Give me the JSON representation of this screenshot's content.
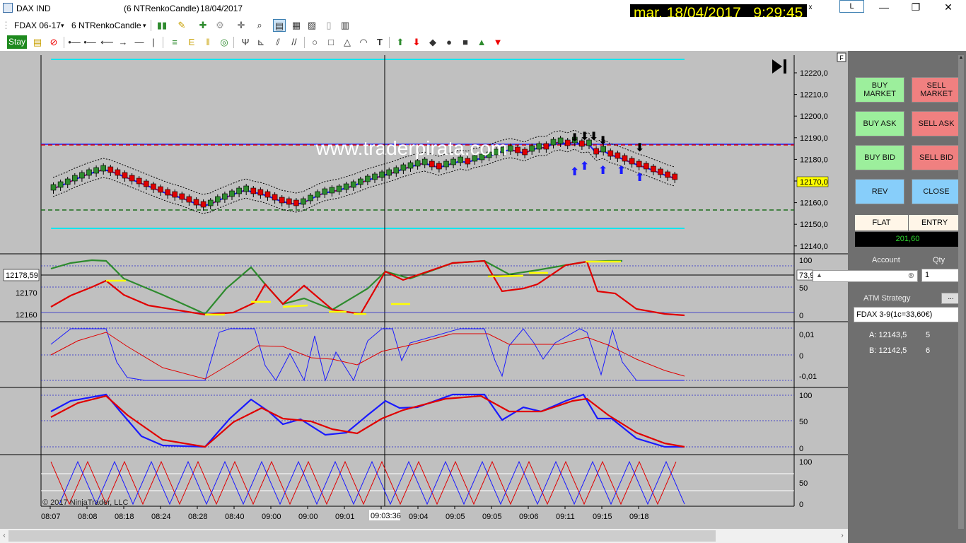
{
  "titlebar": {
    "instrument": "DAX IND",
    "chart_desc": "(6 NTRenkoCandle)",
    "date": "18/04/2017",
    "clock": "mar. 18/04/2017   9:29:45",
    "clock_close": "x",
    "layout_button": "L",
    "minimize": "—",
    "maximize": "❐",
    "close": "✕"
  },
  "toolbar": {
    "instrument_select": "FDAX 06-17",
    "bar_type_select": "6 NTRenkoCandle",
    "stay_button": "Stay",
    "dropdown_arrow": "▾"
  },
  "chart": {
    "watermark": "www.traderpirata.com",
    "copyright": "© 2017 NinjaTrader, LLC",
    "price_labels": [
      "12220,0",
      "12210,0",
      "12200,0",
      "12190,0",
      "12180,0",
      "12170,0",
      "12160,0",
      "12150,0",
      "12140,0"
    ],
    "current_price": "12170,0",
    "crosshair_price": "12178,59",
    "crosshair_time": "09:03:36",
    "left_axis_labels": [
      "12170",
      "12160"
    ],
    "panel2_labels": [
      "100",
      "73,9",
      "50",
      "0"
    ],
    "panel3_labels": [
      "0,01",
      "0",
      "-0,01"
    ],
    "panel4_labels": [
      "100",
      "50",
      "0"
    ],
    "panel5_labels": [
      "100",
      "50",
      "0"
    ],
    "time_labels": [
      "08:07",
      "08:08",
      "08:18",
      "08:24",
      "08:28",
      "08:40",
      "09:00",
      "09:00",
      "09:01",
      "09:04",
      "09:04",
      "09:05",
      "09:05",
      "09:06",
      "09:11",
      "09:15",
      "09:18"
    ],
    "f_button": "F",
    "replay_icon": "step-forward-icon"
  },
  "side_panel": {
    "buy_market": "BUY MARKET",
    "sell_market": "SELL MARKET",
    "buy_ask": "BUY ASK",
    "sell_ask": "SELL ASK",
    "buy_bid": "BUY BID",
    "sell_bid": "SELL BID",
    "rev": "REV",
    "close": "CLOSE",
    "position": "FLAT",
    "entry": "ENTRY",
    "pnl": "201,60",
    "account_label": "Account",
    "qty_label": "Qty",
    "qty_value": "1",
    "atm_label": "ATM Strategy",
    "atm_dots": "...",
    "atm_value": "FDAX 3-9(1c=33,60€)",
    "level_a": "A: 12143,5",
    "level_a_size": "5",
    "level_b": "B: 12142,5",
    "level_b_size": "6"
  },
  "colors": {
    "chart_bg": "#c0c0c0",
    "up_candle": "#2e8b2e",
    "down_candle": "#e00000",
    "cyan_line": "#00e5ee",
    "clock_fg": "#ffff00"
  }
}
